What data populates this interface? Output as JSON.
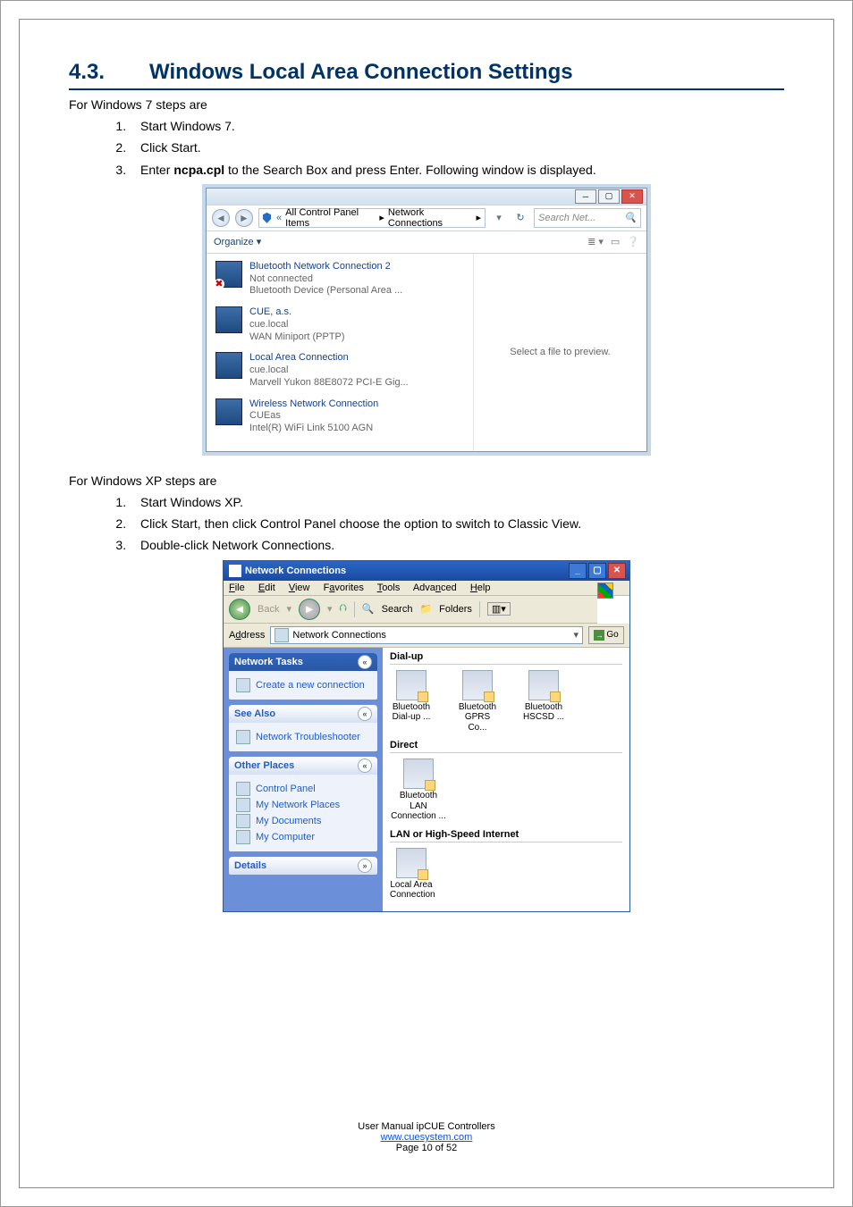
{
  "heading": {
    "number": "4.3.",
    "title": "Windows Local Area Connection Settings"
  },
  "win7": {
    "intro": "For Windows 7 steps are",
    "steps": [
      "Start Windows 7.",
      "Click Start.",
      "Enter <b>ncpa.cpl</b> to the Search Box and press Enter. Following window is displayed."
    ],
    "breadcrumb_prefix": "«",
    "breadcrumb_mid": "All Control Panel Items",
    "breadcrumb_last": "Network Connections",
    "search_placeholder": "Search Net...",
    "organize": "Organize ▾",
    "preview_msg": "Select a file to preview.",
    "connections": [
      {
        "l1": "Bluetooth Network Connection 2",
        "l2": "Not connected",
        "l3": "Bluetooth Device (Personal Area ...",
        "off": true
      },
      {
        "l1": "CUE, a.s.",
        "l2": "cue.local",
        "l3": "WAN Miniport (PPTP)",
        "off": false
      },
      {
        "l1": "Local Area Connection",
        "l2": "cue.local",
        "l3": "Marvell Yukon 88E8072 PCI-E Gig...",
        "off": false
      },
      {
        "l1": "Wireless Network Connection",
        "l2": "CUEas",
        "l3": "Intel(R) WiFi Link 5100 AGN",
        "off": false
      }
    ]
  },
  "xp": {
    "intro": "For Windows XP steps are",
    "steps": [
      "Start Windows XP.",
      "Click Start, then click Control Panel choose the option to switch to Classic View.",
      "Double-click Network Connections."
    ],
    "title": "Network Connections",
    "menus": [
      "File",
      "Edit",
      "View",
      "Favorites",
      "Tools",
      "Advanced",
      "Help"
    ],
    "toolbar": {
      "back": "Back",
      "search": "Search",
      "folders": "Folders"
    },
    "address_label": "Address",
    "address_value": "Network Connections",
    "go": "Go",
    "side": {
      "network_tasks": "Network Tasks",
      "create_conn": "Create a new connection",
      "see_also": "See Also",
      "troubleshooter": "Network Troubleshooter",
      "other_places": "Other Places",
      "places": [
        "Control Panel",
        "My Network Places",
        "My Documents",
        "My Computer"
      ],
      "details": "Details"
    },
    "groups": {
      "dialup": "Dial-up",
      "dialup_items": [
        {
          "l1": "Bluetooth",
          "l2": "Dial-up ..."
        },
        {
          "l1": "Bluetooth",
          "l2": "GPRS Co..."
        },
        {
          "l1": "Bluetooth",
          "l2": "HSCSD ..."
        }
      ],
      "direct": "Direct",
      "direct_items": [
        {
          "l1": "Bluetooth LAN",
          "l2": "Connection ..."
        }
      ],
      "lan": "LAN or High-Speed Internet",
      "lan_items": [
        {
          "l1": "Local Area",
          "l2": "Connection"
        }
      ]
    }
  },
  "footer": {
    "line1": "User Manual ipCUE Controllers",
    "link": "www.cuesystem.com",
    "line3": "Page 10 of 52"
  }
}
